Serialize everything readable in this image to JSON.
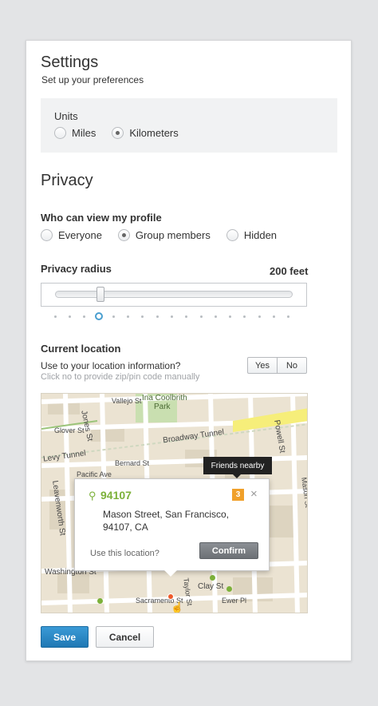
{
  "header": {
    "title": "Settings",
    "subtitle": "Set up your preferences"
  },
  "units": {
    "label": "Units",
    "options": [
      {
        "label": "Miles",
        "selected": false
      },
      {
        "label": "Kilometers",
        "selected": true
      }
    ]
  },
  "privacy": {
    "title": "Privacy",
    "view_label": "Who can view my profile",
    "view_options": [
      {
        "label": "Everyone",
        "selected": false
      },
      {
        "label": "Group members",
        "selected": true
      },
      {
        "label": "Hidden",
        "selected": false
      }
    ],
    "radius_label": "Privacy radius",
    "radius_value": "200 feet",
    "radius_step_selected": 3,
    "radius_steps": 17
  },
  "location": {
    "label": "Current location",
    "question": "Use to your location information?",
    "hint": "Click no to provide zip/pin code manually",
    "yes_label": "Yes",
    "no_label": "No",
    "map": {
      "streets": [
        "Ina Coolbrith",
        "Park",
        "Jones St",
        "Vallejo St",
        "Glover St",
        "Broadway Tunnel",
        "Powell St",
        "Levy Tunnel",
        "Bernard St",
        "Pacific Ave",
        "Leavenworth St",
        "Taylor St",
        "Mason St",
        "Washington St",
        "Clay St",
        "Ewer Pl",
        "Sacramento St"
      ],
      "tooltip": "Friends nearby",
      "popup": {
        "zip": "94107",
        "count": "3",
        "close": "×",
        "address_line1": "Mason Street, San Francisco,",
        "address_line2": "94107, CA",
        "question": "Use this location?",
        "confirm_label": "Confirm"
      }
    }
  },
  "actions": {
    "save_label": "Save",
    "cancel_label": "Cancel"
  },
  "colors": {
    "accent": "#1f78b4",
    "pin_green": "#7cb13a",
    "badge_orange": "#f0a02a"
  }
}
